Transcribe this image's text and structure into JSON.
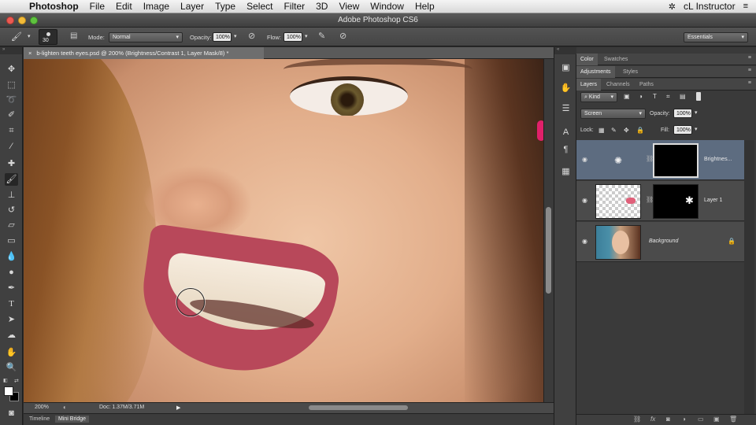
{
  "menubar": {
    "app": "Photoshop",
    "items": [
      "File",
      "Edit",
      "Image",
      "Layer",
      "Type",
      "Select",
      "Filter",
      "3D",
      "View",
      "Window",
      "Help"
    ],
    "user": "cL Instructor"
  },
  "window": {
    "title": "Adobe Photoshop CS6"
  },
  "options": {
    "brush_size": "30",
    "mode_label": "Mode:",
    "mode_value": "Normal",
    "opacity_label": "Opacity:",
    "opacity_value": "100%",
    "flow_label": "Flow:",
    "flow_value": "100%",
    "workspace": "Essentials"
  },
  "document": {
    "tab_label": "b-lighten teeth eyes.psd @ 200% (Brightness/Contrast 1, Layer Mask/8) *",
    "close_glyph": "×"
  },
  "status": {
    "zoom": "200%",
    "doc_info": "Doc: 1.37M/3.71M"
  },
  "bottom_tabs": [
    "Timeline",
    "Mini Bridge"
  ],
  "panels": {
    "group1": [
      "Color",
      "Swatches"
    ],
    "group2": [
      "Adjustments",
      "Styles"
    ],
    "group3": [
      "Layers",
      "Channels",
      "Paths"
    ],
    "kind_filter": "Kind",
    "blend_mode": "Screen",
    "opacity_label": "Opacity:",
    "opacity_value": "100%",
    "lock_label": "Lock:",
    "fill_label": "Fill:",
    "fill_value": "100%",
    "layers": [
      {
        "name": "Brightnes...",
        "selected": true
      },
      {
        "name": "Layer 1",
        "selected": false
      },
      {
        "name": "Background",
        "selected": false
      }
    ]
  },
  "colors": {
    "selected_layer": "#5d6c80",
    "panel_bg": "#3a3a3a",
    "accent_magenta": "#e0206a"
  }
}
